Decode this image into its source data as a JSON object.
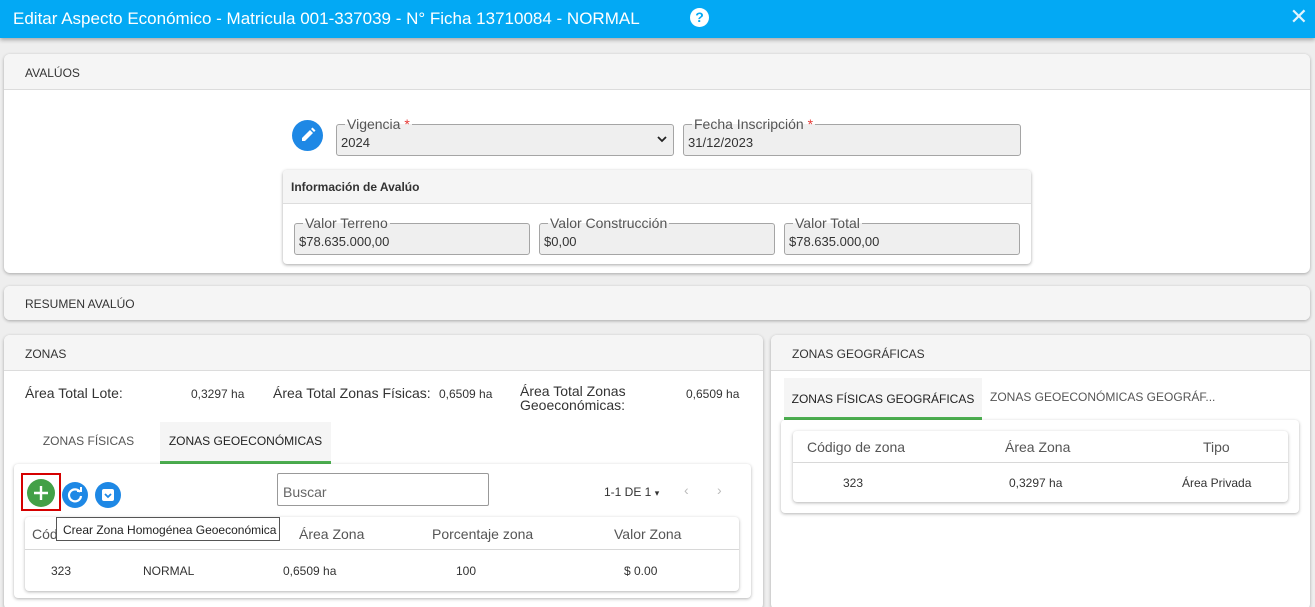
{
  "window": {
    "title": "Editar Aspecto Económico - Matricula 001-337039 - N° Ficha 13710084 - NORMAL",
    "help_icon": "?",
    "close_icon": "✕"
  },
  "avaluos": {
    "header": "AVALÚOS",
    "vigencia": {
      "label": "Vigencia",
      "required": "*",
      "value": "2024"
    },
    "fecha_inscripcion": {
      "label": "Fecha Inscripción",
      "required": "*",
      "value": "31/12/2023"
    },
    "info": {
      "title": "Información de Avalúo",
      "valor_terreno": {
        "label": "Valor Terreno",
        "value": "$78.635.000,00"
      },
      "valor_construccion": {
        "label": "Valor Construcción",
        "value": "$0,00"
      },
      "valor_total": {
        "label": "Valor Total",
        "value": "$78.635.000,00"
      }
    }
  },
  "resumen": {
    "header": "RESUMEN AVALÚO"
  },
  "zonas": {
    "header": "ZONAS",
    "area_total_lote": {
      "label": "Área Total Lote:",
      "value": "0,3297 ha"
    },
    "area_total_fisicas": {
      "label": "Área Total Zonas Físicas:",
      "value": "0,6509 ha"
    },
    "area_total_geoeconomicas": {
      "label": "Área Total Zonas Geoeconómicas:",
      "value": "0,6509 ha"
    },
    "tabs": [
      "ZONAS FÍSICAS",
      "ZONAS GEOECONÓMICAS"
    ],
    "search_placeholder": "Buscar",
    "pager": "1-1 DE 1",
    "pager_prev": "‹",
    "pager_next": "›",
    "tooltip": "Crear Zona Homogénea Geoeconómica",
    "columns": [
      "Cód",
      "Área Zona",
      "Porcentaje zona",
      "Valor Zona"
    ],
    "rows": [
      {
        "codigo": "323",
        "zona": "NORMAL",
        "area": "0,6509 ha",
        "porcentaje": "100",
        "valor": "$ 0.00"
      }
    ]
  },
  "zonas_geograficas": {
    "header": "ZONAS GEOGRÁFICAS",
    "tabs": [
      "ZONAS FÍSICAS GEOGRÁFICAS",
      "ZONAS GEOECONÓMICAS GEOGRÁF..."
    ],
    "columns": [
      "Código de zona",
      "Área Zona",
      "Tipo"
    ],
    "rows": [
      {
        "codigo": "323",
        "area": "0,3297 ha",
        "tipo": "Área Privada"
      }
    ]
  },
  "colors": {
    "accent": "#03a9f4",
    "active_tab": "#4caf50",
    "add_button": "#43a047",
    "highlight": "#d50000"
  }
}
